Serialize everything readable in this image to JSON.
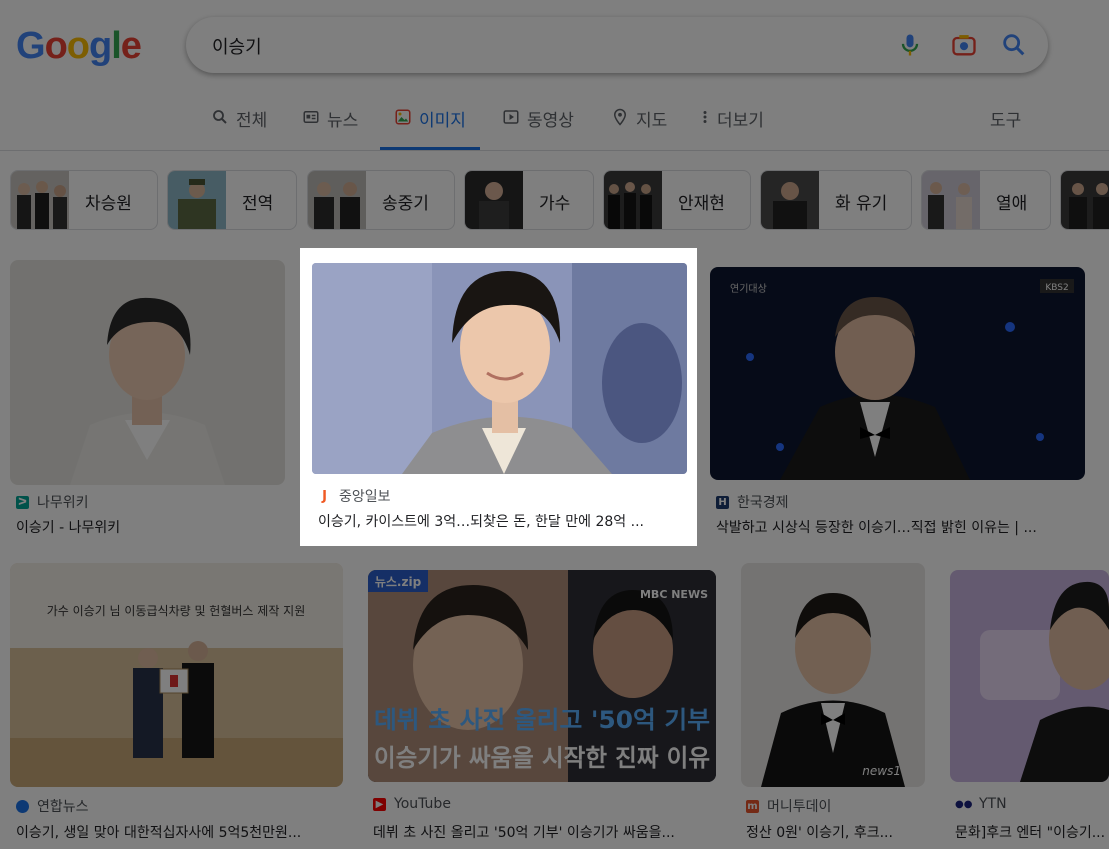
{
  "logo": [
    "G",
    "o",
    "o",
    "g",
    "l",
    "e"
  ],
  "search": {
    "query": "이승기"
  },
  "tabs": [
    {
      "label": "전체",
      "icon": "search-icon"
    },
    {
      "label": "뉴스",
      "icon": "news-icon"
    },
    {
      "label": "이미지",
      "icon": "image-icon",
      "active": true
    },
    {
      "label": "동영상",
      "icon": "play-icon"
    },
    {
      "label": "지도",
      "icon": "map-pin-icon"
    },
    {
      "label": "더보기",
      "icon": "more-vert-icon"
    }
  ],
  "tools_label": "도구",
  "chips": [
    "차승원",
    "전역",
    "송중기",
    "가수",
    "안재현",
    "화 유기",
    "열애"
  ],
  "results": [
    {
      "source": "나무위키",
      "title": "이승기 - 나무위키",
      "favicon_color": "#00a495"
    },
    {
      "source": "중앙일보",
      "title": "이승기, 카이스트에 3억…되찾은 돈, 한달 만에 28억 ...",
      "favicon_color": "#f05a24"
    },
    {
      "source": "한국경제",
      "title": "삭발하고 시상식 등장한 이승기…직접 밝힌 이유는 | ...",
      "favicon_color": "#1d3b6f"
    },
    {
      "source": "연합뉴스",
      "title": "이승기, 생일 맞아 대한적십자사에 5억5천만원...",
      "favicon_color": "#1a73e8"
    },
    {
      "source": "YouTube",
      "title": "데뷔 초 사진 올리고 '50억 기부' 이승기가 싸움을...",
      "favicon_color": "#ff0000"
    },
    {
      "source": "머니투데이",
      "title": "정산 0원' 이승기, 후크...",
      "favicon_color": "#e8542c"
    },
    {
      "source": "YTN",
      "title": "문화]후크 엔터 \"이승기...",
      "favicon_color": "#1a237e"
    }
  ],
  "image_text": {
    "kbs": "KBS2",
    "award": "연기대상",
    "banner": "가수 이승기 님 이동급식차량 및 헌혈버스 제작 지원",
    "news_zip": "뉴스.zip",
    "mbc": "MBC NEWS",
    "cap1": "데뷔 초 사진 올리고 '50억 기부",
    "cap2": "이승기가 싸움을 시작한 진짜 이유",
    "news1": "news1"
  }
}
